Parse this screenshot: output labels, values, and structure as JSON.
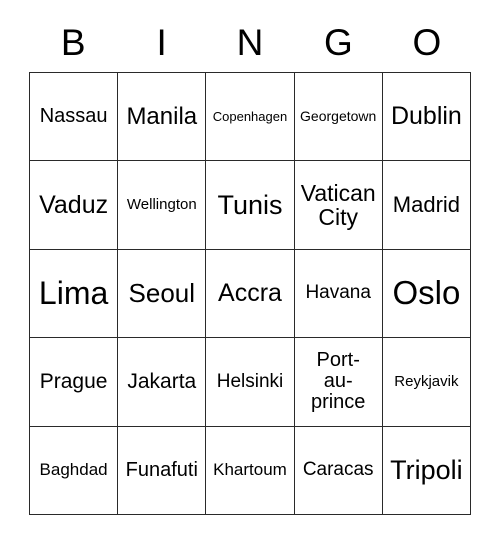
{
  "card": {
    "columns": [
      {
        "letter": "B"
      },
      {
        "letter": "I"
      },
      {
        "letter": "N"
      },
      {
        "letter": "G"
      },
      {
        "letter": "O"
      }
    ],
    "header_letters": [
      "B",
      "I",
      "N",
      "G",
      "O"
    ],
    "grid_colors": {
      "border": "#2a2a2a",
      "background": "#ffffff",
      "text": "#000000"
    },
    "rows": [
      [
        {
          "label": "Nassau",
          "font_size": 20
        },
        {
          "label": "Manila",
          "font_size": 24
        },
        {
          "label": "Copenhagen",
          "font_size": 13
        },
        {
          "label": "Georgetown",
          "font_size": 14
        },
        {
          "label": "Dublin",
          "font_size": 25
        }
      ],
      [
        {
          "label": "Vaduz",
          "font_size": 25
        },
        {
          "label": "Wellington",
          "font_size": 15
        },
        {
          "label": "Tunis",
          "font_size": 27
        },
        {
          "label": "Vatican\nCity",
          "font_size": 23
        },
        {
          "label": "Madrid",
          "font_size": 22
        }
      ],
      [
        {
          "label": "Lima",
          "font_size": 32
        },
        {
          "label": "Seoul",
          "font_size": 26
        },
        {
          "label": "Accra",
          "font_size": 25
        },
        {
          "label": "Havana",
          "font_size": 19
        },
        {
          "label": "Oslo",
          "font_size": 33
        }
      ],
      [
        {
          "label": "Prague",
          "font_size": 21
        },
        {
          "label": "Jakarta",
          "font_size": 21
        },
        {
          "label": "Helsinki",
          "font_size": 19
        },
        {
          "label": "Port-\nau-\nprince",
          "font_size": 20
        },
        {
          "label": "Reykjavik",
          "font_size": 15
        }
      ],
      [
        {
          "label": "Baghdad",
          "font_size": 17
        },
        {
          "label": "Funafuti",
          "font_size": 20
        },
        {
          "label": "Khartoum",
          "font_size": 17
        },
        {
          "label": "Caracas",
          "font_size": 19
        },
        {
          "label": "Tripoli",
          "font_size": 27
        }
      ]
    ]
  }
}
